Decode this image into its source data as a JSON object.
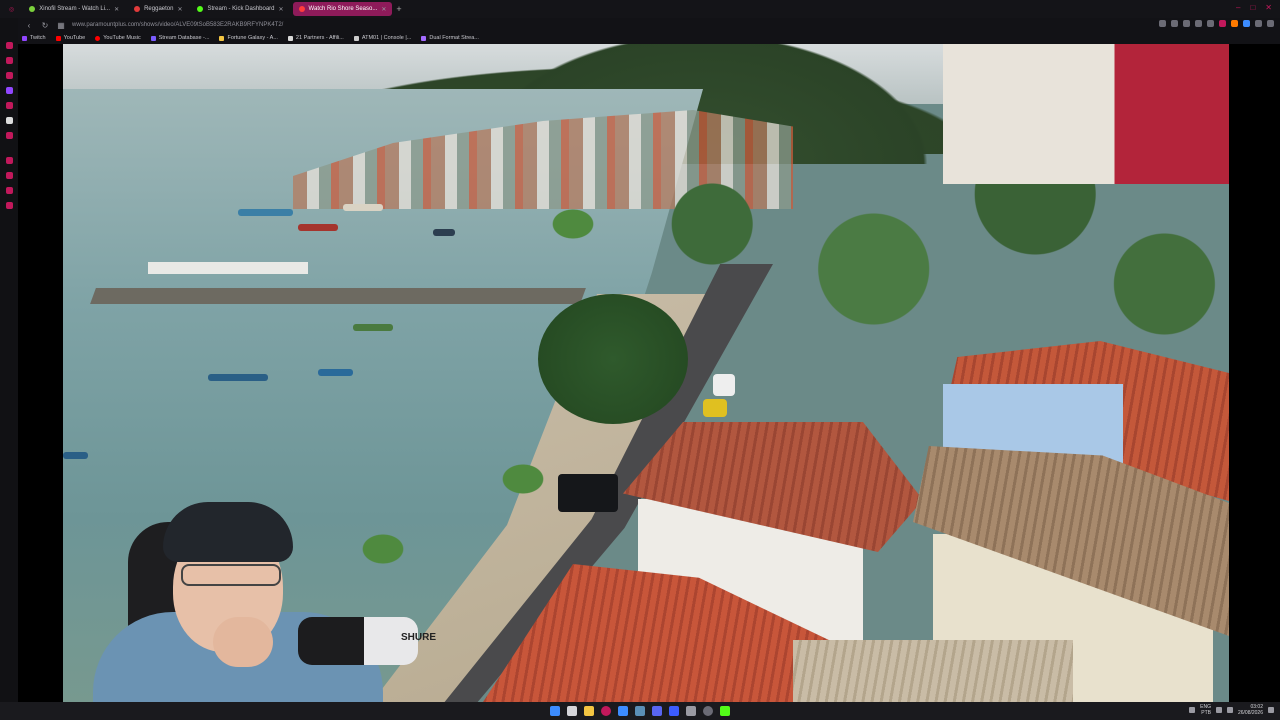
{
  "browser": {
    "tabs": [
      {
        "label": "Xinofil Stream - Watch Li...",
        "color": "#7bd13c",
        "active": false
      },
      {
        "label": "Reggaeton",
        "color": "#e23b3b",
        "active": false
      },
      {
        "label": "Stream - Kick Dashboard",
        "color": "#53fc18",
        "active": false
      },
      {
        "label": "Watch Rio Shore Seaso...",
        "color": "#ff3c3c",
        "active": true
      }
    ],
    "new_tab_symbol": "+",
    "url": "www.paramountplus.com/shows/video/ALVE09tSoB583E2RAKB9RFYNPK4T2/",
    "bookmarks": [
      {
        "label": "Twitch",
        "color": "#9146ff"
      },
      {
        "label": "YouTube",
        "color": "#ff0000"
      },
      {
        "label": "YouTube Music",
        "color": "#ff0000"
      },
      {
        "label": "Stream Database -...",
        "color": "#7a5cff"
      },
      {
        "label": "Fortune Galaxy - A...",
        "color": "#f3c542"
      },
      {
        "label": "21 Partners - Affili...",
        "color": "#d8d8d8"
      },
      {
        "label": "ATM01 | Console |...",
        "color": "#cccccc"
      },
      {
        "label": "Dual Format Strea...",
        "color": "#a36bff"
      }
    ],
    "window_controls": [
      "–",
      "□",
      "✕"
    ]
  },
  "webcam": {
    "mic_brand": "SHURE"
  },
  "taskbar": {
    "lang_top": "ENG",
    "lang_bottom": "PTB",
    "time": "03:02",
    "date": "26/08/2026"
  },
  "colors": {
    "accent": "#8e1b5a",
    "sidebar_accent": "#c2185b"
  }
}
